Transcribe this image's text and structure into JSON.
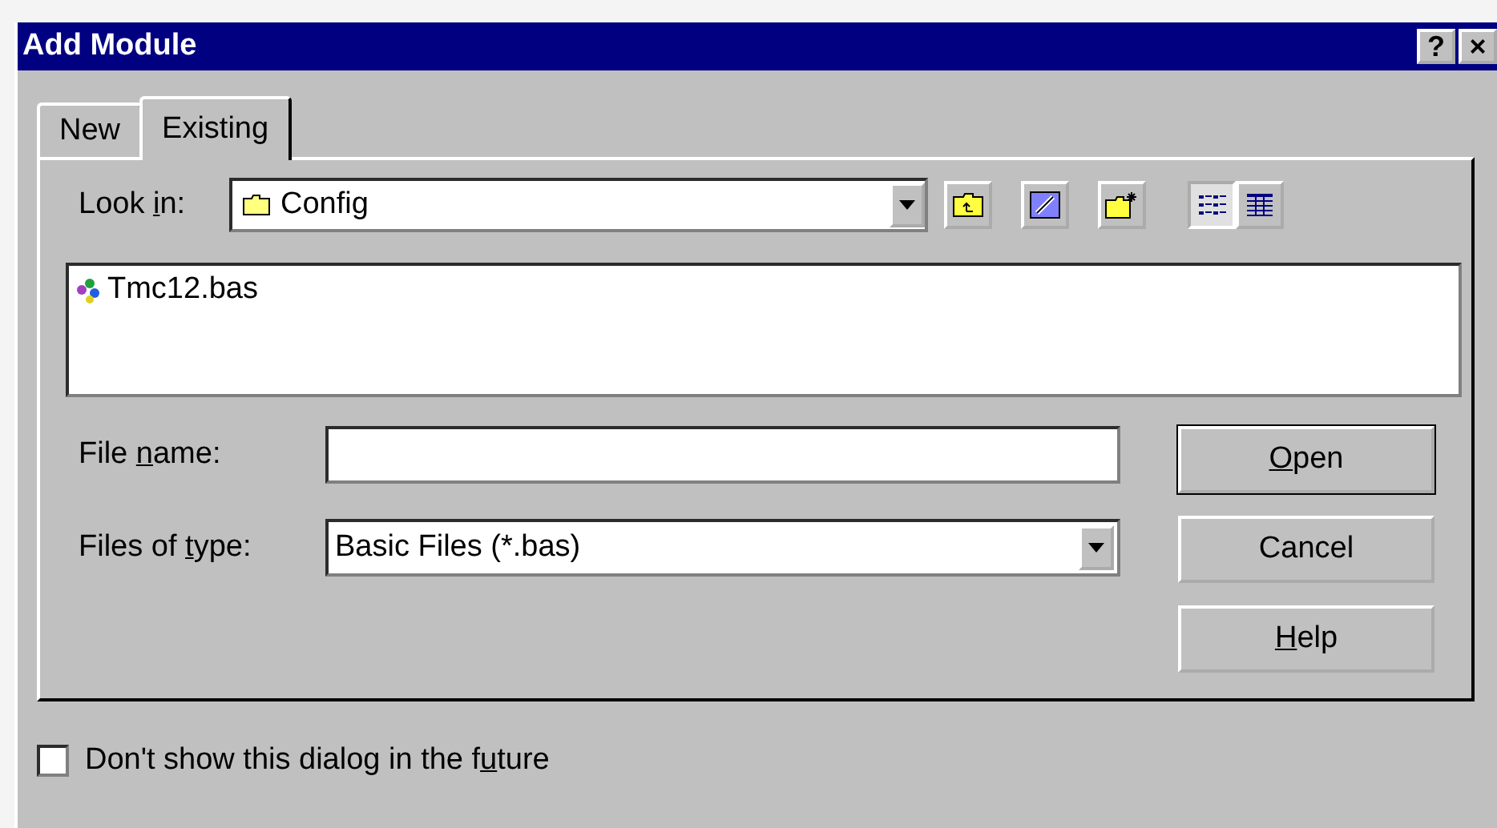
{
  "window": {
    "title": "Add Module",
    "help_button": "?",
    "close_button": "×"
  },
  "tabs": [
    {
      "label": "New",
      "selected": false
    },
    {
      "label": "Existing",
      "selected": true
    }
  ],
  "look_in": {
    "pre": "Look ",
    "key": "i",
    "post": "n:",
    "value": "Config"
  },
  "files": [
    {
      "name": "Tmc12.bas"
    }
  ],
  "fields": [
    {
      "kind": "text",
      "pre": "File ",
      "key": "n",
      "post": "ame:"
    },
    {
      "kind": "dropdown",
      "pre": "Files of ",
      "key": "t",
      "post": "ype:",
      "value": "Basic Files (*.bas)"
    }
  ],
  "buttons": [
    {
      "key": "O",
      "post": "pen",
      "default": true
    },
    {
      "pre": "Cancel",
      "default": false
    },
    {
      "key": "H",
      "post": "elp",
      "default": false
    }
  ],
  "checkbox": {
    "pre": "Don't show this dialog in the f",
    "key": "u",
    "post": "ture",
    "checked": false
  }
}
